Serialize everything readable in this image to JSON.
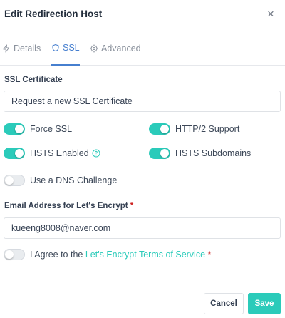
{
  "modal": {
    "title": "Edit Redirection Host",
    "close_label": "×"
  },
  "tabs": [
    {
      "label": "Details",
      "icon": "bolt-icon",
      "active": false
    },
    {
      "label": "SSL",
      "icon": "shield-icon",
      "active": true
    },
    {
      "label": "Advanced",
      "icon": "gear-icon",
      "active": false
    }
  ],
  "ssl": {
    "certificate_label": "SSL Certificate",
    "certificate_value": "Request a new SSL Certificate",
    "toggles": {
      "force_ssl": {
        "label": "Force SSL",
        "on": true
      },
      "http2": {
        "label": "HTTP/2 Support",
        "on": true
      },
      "hsts_enabled": {
        "label": "HSTS Enabled",
        "on": true
      },
      "hsts_subdomains": {
        "label": "HSTS Subdomains",
        "on": true
      },
      "dns_challenge": {
        "label": "Use a DNS Challenge",
        "on": false
      }
    },
    "email_label": "Email Address for Let's Encrypt",
    "email_required": "*",
    "email_value": "kueeng8008@naver.com",
    "agree": {
      "prefix": "I Agree to the ",
      "link": "Let's Encrypt Terms of Service",
      "required": "*",
      "on": false
    }
  },
  "footer": {
    "cancel_label": "Cancel",
    "save_label": "Save"
  },
  "colors": {
    "accent": "#2bcbba",
    "tab_active": "#467fcf",
    "required": "#cd201f"
  }
}
